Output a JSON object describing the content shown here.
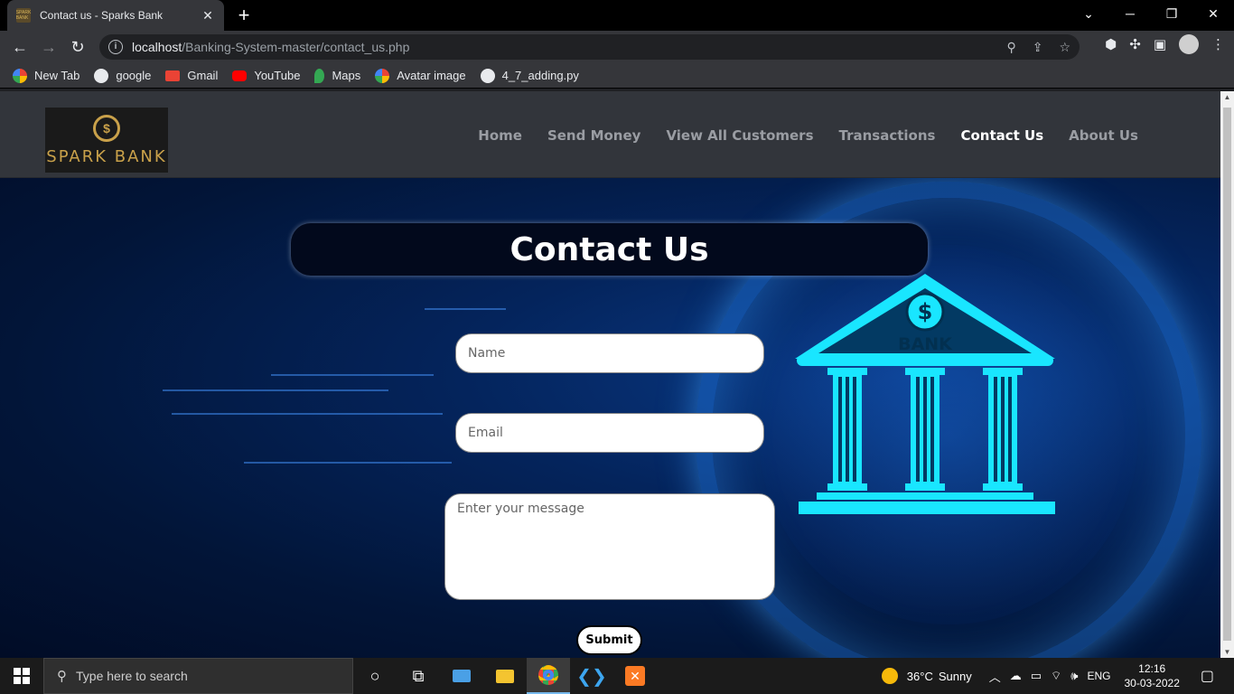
{
  "browser": {
    "tab_title": "Contact us - Sparks Bank",
    "favicon_text": "SPARK BANK",
    "url_host": "localhost",
    "url_path": "/Banking-System-master/contact_us.php",
    "bookmarks": [
      {
        "label": "New Tab",
        "icon": "google-icon",
        "color": "#ffffff"
      },
      {
        "label": "google",
        "icon": "globe-icon",
        "color": "#e8eaed"
      },
      {
        "label": "Gmail",
        "icon": "gmail-icon",
        "color": "#ea4335"
      },
      {
        "label": "YouTube",
        "icon": "youtube-icon",
        "color": "#ff0000"
      },
      {
        "label": "Maps",
        "icon": "maps-icon",
        "color": "#34a853"
      },
      {
        "label": "Avatar image",
        "icon": "photos-icon",
        "color": "#fbbc04"
      },
      {
        "label": "4_7_adding.py",
        "icon": "globe-icon",
        "color": "#e8eaed"
      }
    ]
  },
  "site": {
    "logo_text": "SPARK BANK",
    "logo_symbol": "$",
    "nav": [
      {
        "label": "Home",
        "active": false
      },
      {
        "label": "Send Money",
        "active": false
      },
      {
        "label": "View All Customers",
        "active": false
      },
      {
        "label": "Transactions",
        "active": false
      },
      {
        "label": "Contact Us",
        "active": true
      },
      {
        "label": "About Us",
        "active": false
      }
    ],
    "heading": "Contact Us",
    "form": {
      "name_placeholder": "Name",
      "email_placeholder": "Email",
      "message_placeholder": "Enter your message",
      "submit_label": "Submit"
    },
    "bank_illustration_label": "BANK",
    "bank_symbol": "$"
  },
  "taskbar": {
    "search_placeholder": "Type here to search",
    "weather_temp": "36°C",
    "weather_desc": "Sunny",
    "language": "ENG",
    "time": "12:16",
    "date": "30-03-2022"
  },
  "colors": {
    "accent_cyan": "#19e6ff",
    "page_bg": "#021538",
    "navbar_bg": "#32353b"
  }
}
